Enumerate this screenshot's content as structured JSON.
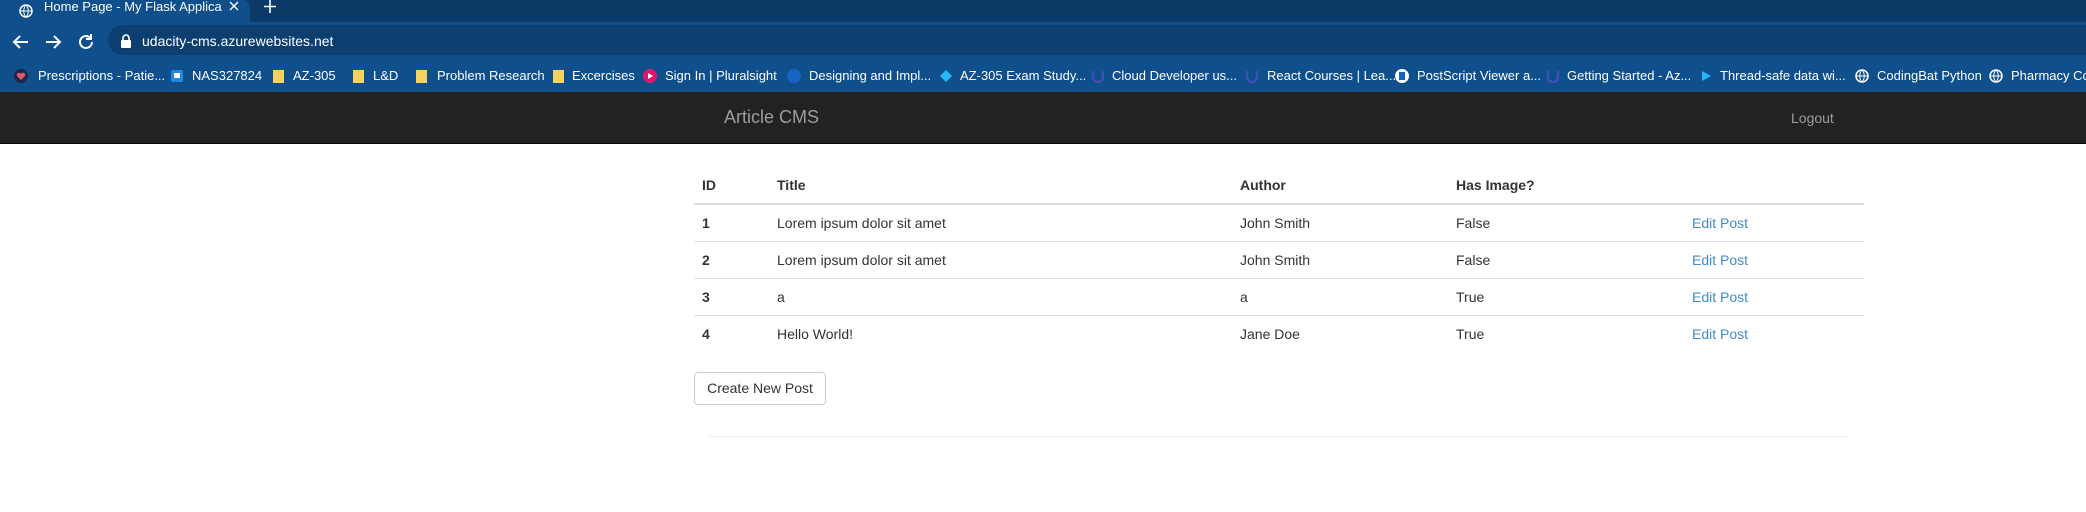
{
  "browser": {
    "tab_title": "Home Page - My Flask Application",
    "url": "udacity-cms.azurewebsites.net",
    "bookmarks": [
      {
        "label": "Prescriptions - Patie...",
        "icon": "heart-icon"
      },
      {
        "label": "NAS327824",
        "icon": "remote-desktop-icon"
      },
      {
        "label": "AZ-305",
        "icon": "folder-icon"
      },
      {
        "label": "L&D",
        "icon": "folder-icon"
      },
      {
        "label": "Problem Research",
        "icon": "folder-icon"
      },
      {
        "label": "Excercises",
        "icon": "folder-icon"
      },
      {
        "label": "Sign In | Pluralsight",
        "icon": "pluralsight-icon"
      },
      {
        "label": "Designing and Impl...",
        "icon": "circle-icon"
      },
      {
        "label": "AZ-305 Exam Study...",
        "icon": "azure-icon"
      },
      {
        "label": "Cloud Developer us...",
        "icon": "udacity-icon"
      },
      {
        "label": "React Courses | Lea...",
        "icon": "udacity-icon"
      },
      {
        "label": "PostScript Viewer a...",
        "icon": "document-icon"
      },
      {
        "label": "Getting Started - Az...",
        "icon": "udacity-icon"
      },
      {
        "label": "Thread-safe data wi...",
        "icon": "play-icon"
      },
      {
        "label": "CodingBat Python",
        "icon": "globe-icon"
      },
      {
        "label": "Pharmacy Cov",
        "icon": "globe-icon"
      }
    ]
  },
  "navbar": {
    "brand": "Article CMS",
    "logout": "Logout"
  },
  "table": {
    "headers": {
      "id": "ID",
      "title": "Title",
      "author": "Author",
      "has_image": "Has Image?"
    },
    "rows": [
      {
        "id": "1",
        "title": "Lorem ipsum dolor sit amet",
        "author": "John Smith",
        "has_image": "False",
        "action": "Edit Post"
      },
      {
        "id": "2",
        "title": "Lorem ipsum dolor sit amet",
        "author": "John Smith",
        "has_image": "False",
        "action": "Edit Post"
      },
      {
        "id": "3",
        "title": "a",
        "author": "a",
        "has_image": "True",
        "action": "Edit Post"
      },
      {
        "id": "4",
        "title": "Hello World!",
        "author": "Jane Doe",
        "has_image": "True",
        "action": "Edit Post"
      }
    ]
  },
  "create_button": "Create New Post",
  "colors": {
    "chrome": "#0f4f8c",
    "navbar": "#222222",
    "link": "#428bca"
  }
}
